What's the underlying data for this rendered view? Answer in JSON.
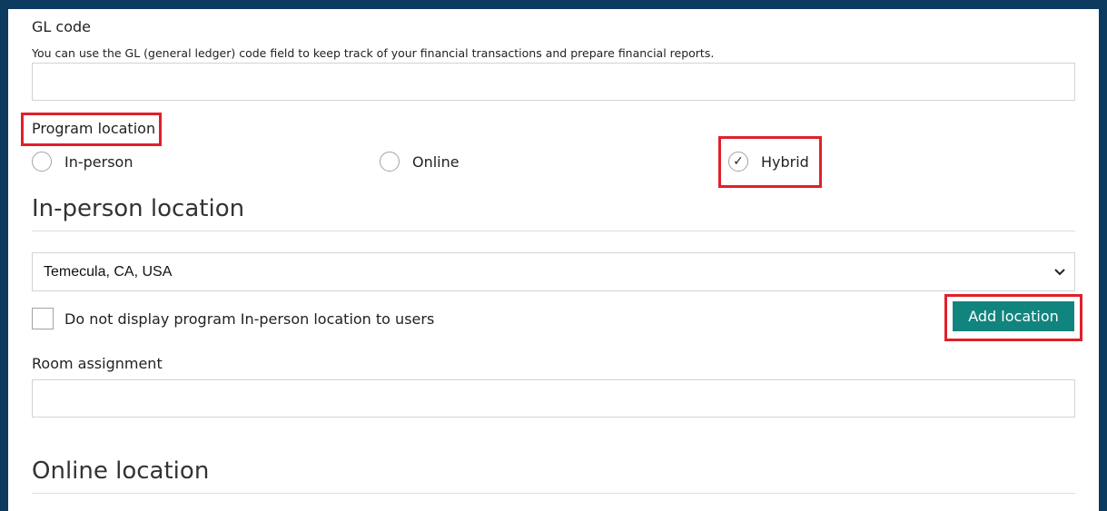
{
  "gl": {
    "label": "GL code",
    "help": "You can use the GL (general ledger) code field to keep track of your financial transactions and prepare financial reports.",
    "value": ""
  },
  "program_location": {
    "label": "Program location",
    "options": [
      {
        "label": "In-person",
        "selected": false
      },
      {
        "label": "Online",
        "selected": false
      },
      {
        "label": "Hybrid",
        "selected": true
      }
    ],
    "check_glyph": "✓"
  },
  "inperson": {
    "title": "In-person location",
    "selected_location": "Temecula, CA, USA",
    "hide_label": "Do not display program In-person location to users",
    "add_button": "Add location"
  },
  "room": {
    "label": "Room assignment",
    "value": ""
  },
  "online": {
    "title": "Online location"
  },
  "colors": {
    "header": "#0d3a5f",
    "accent": "#12847e",
    "highlight": "#e0202a"
  },
  "icons": {
    "dropdown": "chevron-down-icon"
  }
}
